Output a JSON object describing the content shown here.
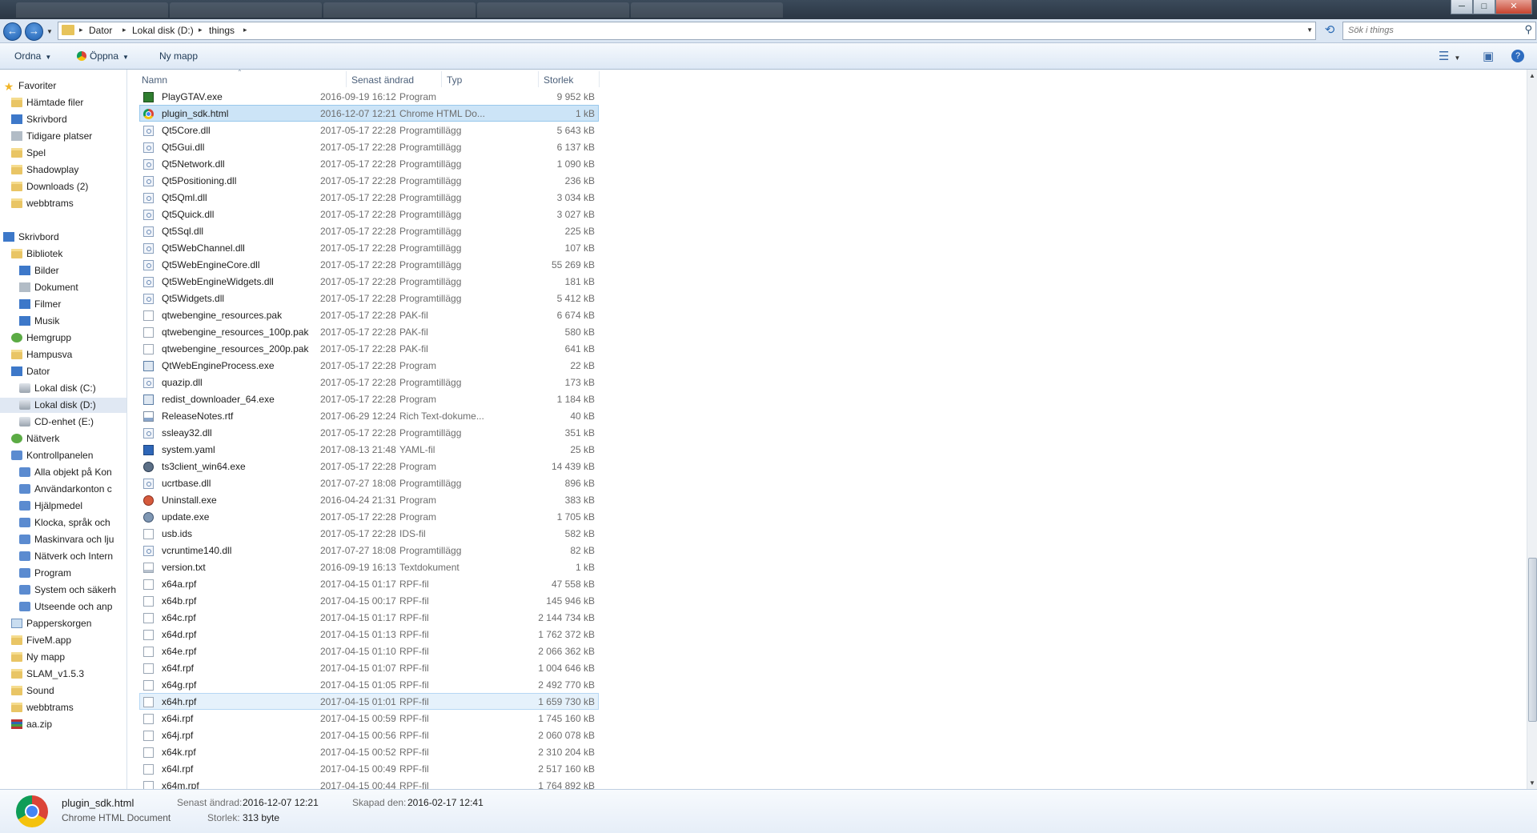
{
  "window": {
    "minimize": "─",
    "maximize": "□",
    "close": "✕"
  },
  "address": {
    "crumbs": [
      "Dator",
      "Lokal disk (D:)",
      "things"
    ],
    "sep": "▸"
  },
  "search": {
    "placeholder": "Sök i things"
  },
  "toolbar": {
    "organize": "Ordna",
    "open": "Öppna",
    "new_folder": "Ny mapp"
  },
  "sidebar": [
    {
      "label": "Favoriter",
      "icon": "star-icon"
    },
    {
      "label": "Hämtade filer",
      "icon": "folder-icon"
    },
    {
      "label": "Skrivbord",
      "icon": "desktop-icon"
    },
    {
      "label": "Tidigare platser",
      "icon": "recent-places-icon"
    },
    {
      "label": "Spel",
      "icon": "folder-icon"
    },
    {
      "label": "Shadowplay",
      "icon": "folder-icon"
    },
    {
      "label": "Downloads (2)",
      "icon": "folder-icon"
    },
    {
      "label": "webbtrams",
      "icon": "folder-icon"
    },
    {
      "label": "Skrivbord",
      "icon": "desktop-icon"
    },
    {
      "label": "Bibliotek",
      "icon": "library-icon"
    },
    {
      "label": "Bilder",
      "icon": "pictures-icon"
    },
    {
      "label": "Dokument",
      "icon": "documents-icon"
    },
    {
      "label": "Filmer",
      "icon": "videos-icon"
    },
    {
      "label": "Musik",
      "icon": "music-icon"
    },
    {
      "label": "Hemgrupp",
      "icon": "homegroup-icon"
    },
    {
      "label": "Hampusva",
      "icon": "user-folder-icon"
    },
    {
      "label": "Dator",
      "icon": "computer-icon"
    },
    {
      "label": "Lokal disk (C:)",
      "icon": "drive-icon"
    },
    {
      "label": "Lokal disk (D:)",
      "icon": "drive-icon"
    },
    {
      "label": "CD-enhet (E:)",
      "icon": "cd-drive-icon"
    },
    {
      "label": "Nätverk",
      "icon": "network-icon"
    },
    {
      "label": "Kontrollpanelen",
      "icon": "control-panel-icon"
    },
    {
      "label": "Alla objekt på Kon",
      "icon": "control-panel-icon"
    },
    {
      "label": "Användarkonton c",
      "icon": "users-icon"
    },
    {
      "label": "Hjälpmedel",
      "icon": "accessibility-icon"
    },
    {
      "label": "Klocka, språk och",
      "icon": "clock-icon"
    },
    {
      "label": "Maskinvara och lju",
      "icon": "hardware-icon"
    },
    {
      "label": "Nätverk och Intern",
      "icon": "network-icon"
    },
    {
      "label": "Program",
      "icon": "programs-icon"
    },
    {
      "label": "System och säkerh",
      "icon": "security-icon"
    },
    {
      "label": "Utseende och anp",
      "icon": "appearance-icon"
    },
    {
      "label": "Papperskorgen",
      "icon": "recycle-bin-icon"
    },
    {
      "label": "FiveM.app",
      "icon": "folder-icon"
    },
    {
      "label": "Ny mapp",
      "icon": "folder-icon"
    },
    {
      "label": "SLAM_v1.5.3",
      "icon": "folder-icon"
    },
    {
      "label": "Sound",
      "icon": "folder-icon"
    },
    {
      "label": "webbtrams",
      "icon": "folder-icon"
    },
    {
      "label": "aa.zip",
      "icon": "zip-icon"
    }
  ],
  "columns": {
    "name": "Namn",
    "modified": "Senast ändrad",
    "type": "Typ",
    "size": "Storlek"
  },
  "files": [
    {
      "name": "PlayGTAV.exe",
      "date": "2016-09-19 16:12",
      "type": "Program",
      "size": "9 952 kB",
      "icon": "exe"
    },
    {
      "name": "plugin_sdk.html",
      "date": "2016-12-07 12:21",
      "type": "Chrome HTML Do...",
      "size": "1 kB",
      "icon": "chrome"
    },
    {
      "name": "Qt5Core.dll",
      "date": "2017-05-17 22:28",
      "type": "Programtillägg",
      "size": "5 643 kB",
      "icon": "dll"
    },
    {
      "name": "Qt5Gui.dll",
      "date": "2017-05-17 22:28",
      "type": "Programtillägg",
      "size": "6 137 kB",
      "icon": "dll"
    },
    {
      "name": "Qt5Network.dll",
      "date": "2017-05-17 22:28",
      "type": "Programtillägg",
      "size": "1 090 kB",
      "icon": "dll"
    },
    {
      "name": "Qt5Positioning.dll",
      "date": "2017-05-17 22:28",
      "type": "Programtillägg",
      "size": "236 kB",
      "icon": "dll"
    },
    {
      "name": "Qt5Qml.dll",
      "date": "2017-05-17 22:28",
      "type": "Programtillägg",
      "size": "3 034 kB",
      "icon": "dll"
    },
    {
      "name": "Qt5Quick.dll",
      "date": "2017-05-17 22:28",
      "type": "Programtillägg",
      "size": "3 027 kB",
      "icon": "dll"
    },
    {
      "name": "Qt5Sql.dll",
      "date": "2017-05-17 22:28",
      "type": "Programtillägg",
      "size": "225 kB",
      "icon": "dll"
    },
    {
      "name": "Qt5WebChannel.dll",
      "date": "2017-05-17 22:28",
      "type": "Programtillägg",
      "size": "107 kB",
      "icon": "dll"
    },
    {
      "name": "Qt5WebEngineCore.dll",
      "date": "2017-05-17 22:28",
      "type": "Programtillägg",
      "size": "55 269 kB",
      "icon": "dll"
    },
    {
      "name": "Qt5WebEngineWidgets.dll",
      "date": "2017-05-17 22:28",
      "type": "Programtillägg",
      "size": "181 kB",
      "icon": "dll"
    },
    {
      "name": "Qt5Widgets.dll",
      "date": "2017-05-17 22:28",
      "type": "Programtillägg",
      "size": "5 412 kB",
      "icon": "dll"
    },
    {
      "name": "qtwebengine_resources.pak",
      "date": "2017-05-17 22:28",
      "type": "PAK-fil",
      "size": "6 674 kB",
      "icon": "blank"
    },
    {
      "name": "qtwebengine_resources_100p.pak",
      "date": "2017-05-17 22:28",
      "type": "PAK-fil",
      "size": "580 kB",
      "icon": "blank"
    },
    {
      "name": "qtwebengine_resources_200p.pak",
      "date": "2017-05-17 22:28",
      "type": "PAK-fil",
      "size": "641 kB",
      "icon": "blank"
    },
    {
      "name": "QtWebEngineProcess.exe",
      "date": "2017-05-17 22:28",
      "type": "Program",
      "size": "22 kB",
      "icon": "prog"
    },
    {
      "name": "quazip.dll",
      "date": "2017-05-17 22:28",
      "type": "Programtillägg",
      "size": "173 kB",
      "icon": "dll"
    },
    {
      "name": "redist_downloader_64.exe",
      "date": "2017-05-17 22:28",
      "type": "Program",
      "size": "1 184 kB",
      "icon": "prog"
    },
    {
      "name": "ReleaseNotes.rtf",
      "date": "2017-06-29 12:24",
      "type": "Rich Text-dokume...",
      "size": "40 kB",
      "icon": "rtf"
    },
    {
      "name": "ssleay32.dll",
      "date": "2017-05-17 22:28",
      "type": "Programtillägg",
      "size": "351 kB",
      "icon": "dll"
    },
    {
      "name": "system.yaml",
      "date": "2017-08-13 21:48",
      "type": "YAML-fil",
      "size": "25 kB",
      "icon": "yaml"
    },
    {
      "name": "ts3client_win64.exe",
      "date": "2017-05-17 22:28",
      "type": "Program",
      "size": "14 439 kB",
      "icon": "ts3"
    },
    {
      "name": "ucrtbase.dll",
      "date": "2017-07-27 18:08",
      "type": "Programtillägg",
      "size": "896 kB",
      "icon": "dll"
    },
    {
      "name": "Uninstall.exe",
      "date": "2016-04-24 21:31",
      "type": "Program",
      "size": "383 kB",
      "icon": "uninst"
    },
    {
      "name": "update.exe",
      "date": "2017-05-17 22:28",
      "type": "Program",
      "size": "1 705 kB",
      "icon": "update"
    },
    {
      "name": "usb.ids",
      "date": "2017-05-17 22:28",
      "type": "IDS-fil",
      "size": "582 kB",
      "icon": "blank"
    },
    {
      "name": "vcruntime140.dll",
      "date": "2017-07-27 18:08",
      "type": "Programtillägg",
      "size": "82 kB",
      "icon": "dll"
    },
    {
      "name": "version.txt",
      "date": "2016-09-19 16:13",
      "type": "Textdokument",
      "size": "1 kB",
      "icon": "txt"
    },
    {
      "name": "x64a.rpf",
      "date": "2017-04-15 01:17",
      "type": "RPF-fil",
      "size": "47 558 kB",
      "icon": "blank"
    },
    {
      "name": "x64b.rpf",
      "date": "2017-04-15 00:17",
      "type": "RPF-fil",
      "size": "145 946 kB",
      "icon": "blank"
    },
    {
      "name": "x64c.rpf",
      "date": "2017-04-15 01:17",
      "type": "RPF-fil",
      "size": "2 144 734 kB",
      "icon": "blank"
    },
    {
      "name": "x64d.rpf",
      "date": "2017-04-15 01:13",
      "type": "RPF-fil",
      "size": "1 762 372 kB",
      "icon": "blank"
    },
    {
      "name": "x64e.rpf",
      "date": "2017-04-15 01:10",
      "type": "RPF-fil",
      "size": "2 066 362 kB",
      "icon": "blank"
    },
    {
      "name": "x64f.rpf",
      "date": "2017-04-15 01:07",
      "type": "RPF-fil",
      "size": "1 004 646 kB",
      "icon": "blank"
    },
    {
      "name": "x64g.rpf",
      "date": "2017-04-15 01:05",
      "type": "RPF-fil",
      "size": "2 492 770 kB",
      "icon": "blank"
    },
    {
      "name": "x64h.rpf",
      "date": "2017-04-15 01:01",
      "type": "RPF-fil",
      "size": "1 659 730 kB",
      "icon": "blank"
    },
    {
      "name": "x64i.rpf",
      "date": "2017-04-15 00:59",
      "type": "RPF-fil",
      "size": "1 745 160 kB",
      "icon": "blank"
    },
    {
      "name": "x64j.rpf",
      "date": "2017-04-15 00:56",
      "type": "RPF-fil",
      "size": "2 060 078 kB",
      "icon": "blank"
    },
    {
      "name": "x64k.rpf",
      "date": "2017-04-15 00:52",
      "type": "RPF-fil",
      "size": "2 310 204 kB",
      "icon": "blank"
    },
    {
      "name": "x64l.rpf",
      "date": "2017-04-15 00:49",
      "type": "RPF-fil",
      "size": "2 517 160 kB",
      "icon": "blank"
    },
    {
      "name": "x64m.rpf",
      "date": "2017-04-15 00:44",
      "type": "RPF-fil",
      "size": "1 764 892 kB",
      "icon": "blank"
    }
  ],
  "selected_file": "plugin_sdk.html",
  "hovered_file": "x64h.rpf",
  "details": {
    "name": "plugin_sdk.html",
    "type": "Chrome HTML Document",
    "modified_label": "Senast ändrad:",
    "modified_value": "2016-12-07 12:21",
    "size_label": "Storlek:",
    "size_value": "313 byte",
    "created_label": "Skapad den:",
    "created_value": "2016-02-17 12:41"
  }
}
